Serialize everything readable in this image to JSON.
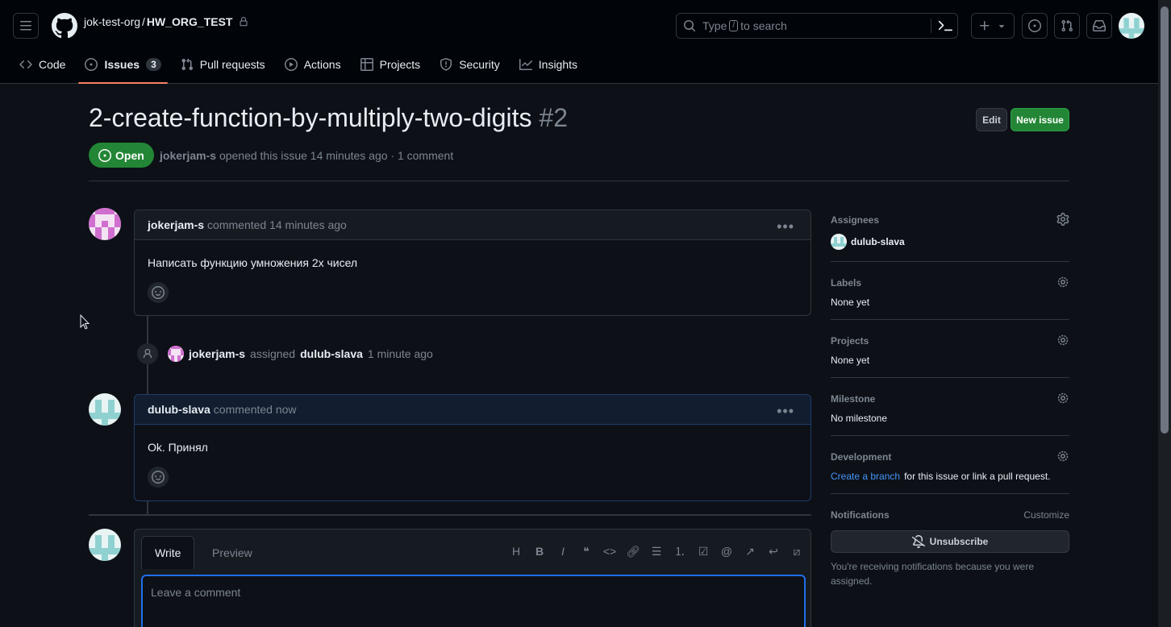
{
  "header": {
    "owner": "jok-test-org",
    "separator": "/",
    "repo": "HW_ORG_TEST",
    "search_placeholder_pre": "Type",
    "search_key": "/",
    "search_placeholder_post": "to search"
  },
  "tabs": [
    {
      "label": "Code"
    },
    {
      "label": "Issues",
      "count": "3"
    },
    {
      "label": "Pull requests"
    },
    {
      "label": "Actions"
    },
    {
      "label": "Projects"
    },
    {
      "label": "Security"
    },
    {
      "label": "Insights"
    }
  ],
  "issue": {
    "title": "2-create-function-by-multiply-two-digits",
    "number": "#2",
    "edit_label": "Edit",
    "new_label": "New issue",
    "state": "Open",
    "author": "jokerjam-s",
    "opened_text": "opened this issue 14 minutes ago · 1 comment"
  },
  "comments": [
    {
      "author": "jokerjam-s",
      "action": "commented 14 minutes ago",
      "body": "Написать функцию умножения 2x чисел"
    },
    {
      "author": "dulub-slava",
      "action": "commented now",
      "body": "Ok. Принял"
    }
  ],
  "event": {
    "actor": "jokerjam-s",
    "verb": "assigned",
    "target": "dulub-slava",
    "time": "1 minute ago"
  },
  "composer": {
    "write_tab": "Write",
    "preview_tab": "Preview",
    "placeholder": "Leave a comment"
  },
  "sidebar": {
    "assignees_title": "Assignees",
    "assignee": "dulub-slava",
    "labels_title": "Labels",
    "labels_value": "None yet",
    "projects_title": "Projects",
    "projects_value": "None yet",
    "milestone_title": "Milestone",
    "milestone_value": "No milestone",
    "development_title": "Development",
    "dev_link": "Create a branch",
    "dev_rest": "for this issue or link a pull request.",
    "notifications_title": "Notifications",
    "customize": "Customize",
    "unsubscribe": "Unsubscribe",
    "notice": "You're receiving notifications because you were assigned."
  },
  "colors": {
    "accent_open": "#238636",
    "link": "#4493f8",
    "tab_underline": "#f78166"
  }
}
